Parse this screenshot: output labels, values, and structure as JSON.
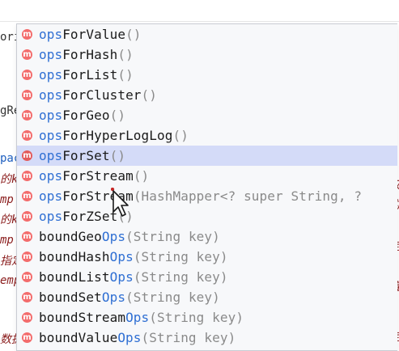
{
  "colors": {
    "highlight": "#2f6fd3",
    "selected_row_bg": "#d4dbf8",
    "method_badge": "#f36c6c",
    "params": "#8a8a8a"
  },
  "editor_background": {
    "left_fragments": [
      {
        "text": "ori",
        "color": "#333333",
        "italic": false
      },
      {
        "text": "gRe",
        "color": "#333333",
        "italic": false
      },
      {
        "text": "pac",
        "color": "#1f5fbf",
        "italic": false
      },
      {
        "text": "的k",
        "color": "#8a1c1c",
        "italic": true
      },
      {
        "text": "mp",
        "color": "#8a1c1c",
        "italic": true
      },
      {
        "text": "的k",
        "color": "#8a1c1c",
        "italic": true
      },
      {
        "text": "mp",
        "color": "#8a1c1c",
        "italic": true
      },
      {
        "text": "指定",
        "color": "#8a1c1c",
        "italic": true
      },
      {
        "text": "emp",
        "color": "#8a1c1c",
        "italic": true
      },
      {
        "text": "数据",
        "color": "#8a1c1c",
        "italic": true
      }
    ],
    "right_fragments": [
      "取",
      "的",
      "定",
      "值",
      "定"
    ]
  },
  "completion_popup": {
    "badge_label": "m",
    "items": [
      {
        "prefix": "ops",
        "rest": "ForValue",
        "suffix": "",
        "params": "()",
        "selected": false
      },
      {
        "prefix": "ops",
        "rest": "ForHash",
        "suffix": "",
        "params": "()",
        "selected": false
      },
      {
        "prefix": "ops",
        "rest": "ForList",
        "suffix": "",
        "params": "()",
        "selected": false
      },
      {
        "prefix": "ops",
        "rest": "ForCluster",
        "suffix": "",
        "params": "()",
        "selected": false
      },
      {
        "prefix": "ops",
        "rest": "ForGeo",
        "suffix": "",
        "params": "()",
        "selected": false
      },
      {
        "prefix": "ops",
        "rest": "ForHyperLogLog",
        "suffix": "",
        "params": "()",
        "selected": false
      },
      {
        "prefix": "ops",
        "rest": "ForSet",
        "suffix": "",
        "params": "()",
        "selected": true
      },
      {
        "prefix": "ops",
        "rest": "ForStream",
        "suffix": "",
        "params": "()",
        "selected": false
      },
      {
        "prefix": "ops",
        "rest": "ForStream",
        "suffix": "",
        "params": "(HashMapper<? super String, ?",
        "selected": false
      },
      {
        "prefix": "ops",
        "rest": "ForZSet",
        "suffix": "",
        "params": "()",
        "selected": false
      },
      {
        "prefix": "",
        "rest": "boundGeo",
        "suffix": "Ops",
        "params": "(String key)",
        "selected": false
      },
      {
        "prefix": "",
        "rest": "boundHash",
        "suffix": "Ops",
        "params": "(String key)",
        "selected": false
      },
      {
        "prefix": "",
        "rest": "boundList",
        "suffix": "Ops",
        "params": "(String key)",
        "selected": false
      },
      {
        "prefix": "",
        "rest": "boundSet",
        "suffix": "Ops",
        "params": "(String key)",
        "selected": false
      },
      {
        "prefix": "",
        "rest": "boundStream",
        "suffix": "Ops",
        "params": "(String key)",
        "selected": false
      },
      {
        "prefix": "",
        "rest": "boundValue",
        "suffix": "Ops",
        "params": "(String key)",
        "selected": false
      }
    ]
  }
}
